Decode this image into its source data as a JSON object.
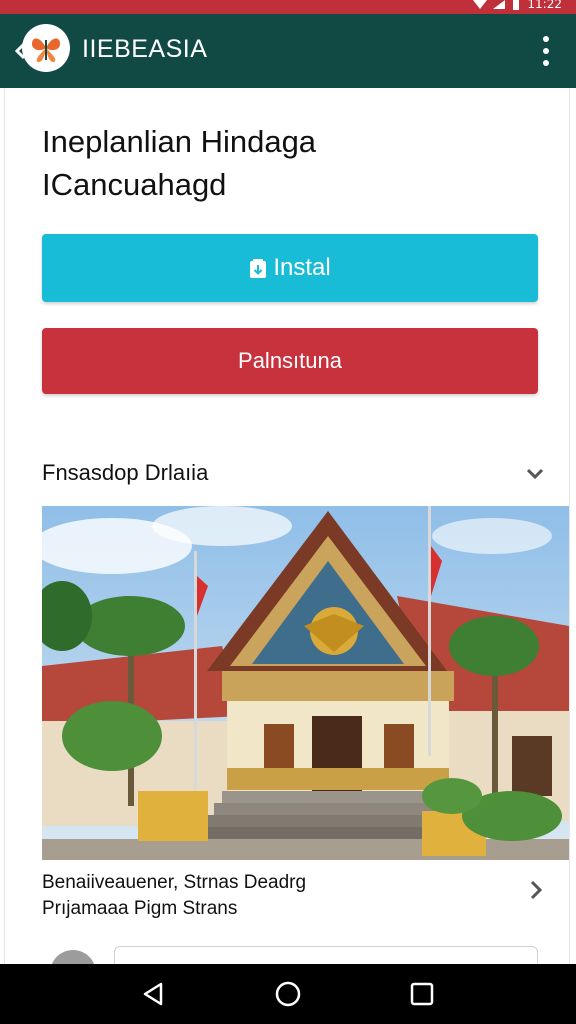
{
  "status_bar": {
    "time": "11:22",
    "icons": [
      "wifi-icon",
      "signal-icon",
      "battery-icon"
    ]
  },
  "app_bar": {
    "title": "IIEBEASIA",
    "background": "#114a45",
    "logo": "butterfly-logo-icon",
    "menu_icon": "overflow-menu-icon"
  },
  "page": {
    "title_line1": "Ineplanlian Hindaga",
    "title_line2": "ICancuahagd"
  },
  "buttons": {
    "install_label": "Instal",
    "install_color": "#19bcd7",
    "secondary_label": "Palnsıtuna",
    "secondary_color": "#c7323d"
  },
  "section": {
    "header": "Fnsasdop Drlaıia",
    "toggle_icon": "chevron-down-icon"
  },
  "photo": {
    "subject": "building-photo"
  },
  "caption": {
    "line1": "Benaiiveauener, Strnas Deadrg",
    "line2": "Prıjamaaa Pigm Strans",
    "chevron": "chevron-right-icon"
  },
  "nav_bar": {
    "buttons": [
      "back-icon",
      "home-icon",
      "recents-icon"
    ]
  }
}
